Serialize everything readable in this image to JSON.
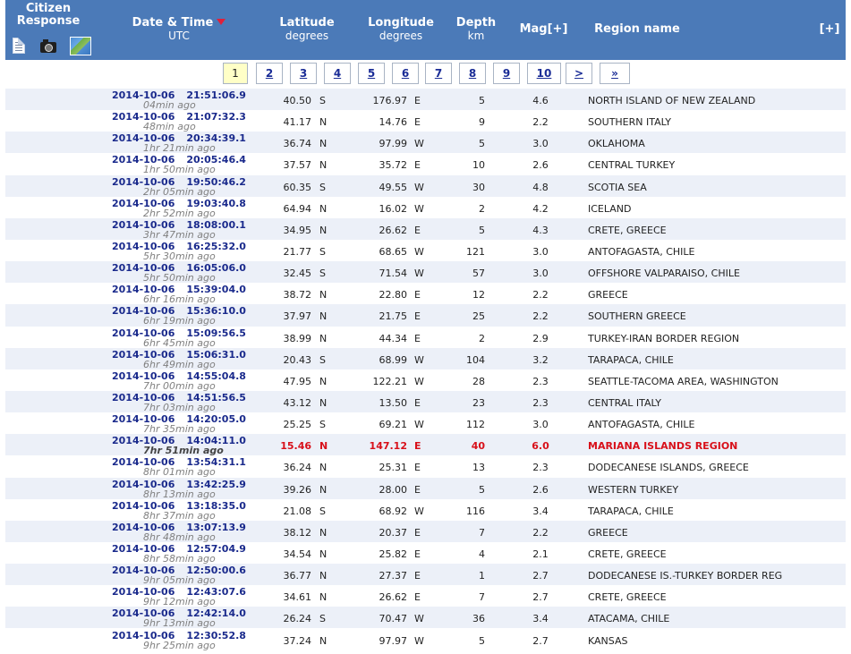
{
  "header": {
    "citizen_response_line1": "Citizen",
    "citizen_response_line2": "Response",
    "icons": [
      "document-icon",
      "camera-icon",
      "map-icon"
    ],
    "datetime_label": "Date & Time",
    "datetime_sub": "UTC",
    "latitude_label": "Latitude",
    "latitude_sub": "degrees",
    "longitude_label": "Longitude",
    "longitude_sub": "degrees",
    "depth_label": "Depth",
    "depth_sub": "km",
    "mag_label": "Mag[+]",
    "region_label": "Region name",
    "expand_label": "[+]",
    "header_bg": "#4b7ab8",
    "sort_arrow_color": "#e0203a"
  },
  "pager": [
    "1",
    "2",
    "3",
    "4",
    "5",
    "6",
    "7",
    "8",
    "9",
    "10",
    ">",
    "»"
  ],
  "pager_active": "1",
  "rows": [
    {
      "date": "2014-10-06",
      "time": "21:51:06.9",
      "ago": "04min ago",
      "lat": "40.50",
      "ns": "S",
      "lon": "176.97",
      "ew": "E",
      "depth": "5",
      "mag": "4.6",
      "region": "NORTH ISLAND OF NEW ZEALAND"
    },
    {
      "date": "2014-10-06",
      "time": "21:07:32.3",
      "ago": "48min ago",
      "lat": "41.17",
      "ns": "N",
      "lon": "14.76",
      "ew": "E",
      "depth": "9",
      "mag": "2.2",
      "region": "SOUTHERN ITALY"
    },
    {
      "date": "2014-10-06",
      "time": "20:34:39.1",
      "ago": "1hr 21min ago",
      "lat": "36.74",
      "ns": "N",
      "lon": "97.99",
      "ew": "W",
      "depth": "5",
      "mag": "3.0",
      "region": "OKLAHOMA"
    },
    {
      "date": "2014-10-06",
      "time": "20:05:46.4",
      "ago": "1hr 50min ago",
      "lat": "37.57",
      "ns": "N",
      "lon": "35.72",
      "ew": "E",
      "depth": "10",
      "mag": "2.6",
      "region": "CENTRAL TURKEY"
    },
    {
      "date": "2014-10-06",
      "time": "19:50:46.2",
      "ago": "2hr 05min ago",
      "lat": "60.35",
      "ns": "S",
      "lon": "49.55",
      "ew": "W",
      "depth": "30",
      "mag": "4.8",
      "region": "SCOTIA SEA"
    },
    {
      "date": "2014-10-06",
      "time": "19:03:40.8",
      "ago": "2hr 52min ago",
      "lat": "64.94",
      "ns": "N",
      "lon": "16.02",
      "ew": "W",
      "depth": "2",
      "mag": "4.2",
      "region": "ICELAND"
    },
    {
      "date": "2014-10-06",
      "time": "18:08:00.1",
      "ago": "3hr 47min ago",
      "lat": "34.95",
      "ns": "N",
      "lon": "26.62",
      "ew": "E",
      "depth": "5",
      "mag": "4.3",
      "region": "CRETE, GREECE"
    },
    {
      "date": "2014-10-06",
      "time": "16:25:32.0",
      "ago": "5hr 30min ago",
      "lat": "21.77",
      "ns": "S",
      "lon": "68.65",
      "ew": "W",
      "depth": "121",
      "mag": "3.0",
      "region": "ANTOFAGASTA, CHILE"
    },
    {
      "date": "2014-10-06",
      "time": "16:05:06.0",
      "ago": "5hr 50min ago",
      "lat": "32.45",
      "ns": "S",
      "lon": "71.54",
      "ew": "W",
      "depth": "57",
      "mag": "3.0",
      "region": "OFFSHORE VALPARAISO, CHILE"
    },
    {
      "date": "2014-10-06",
      "time": "15:39:04.0",
      "ago": "6hr 16min ago",
      "lat": "38.72",
      "ns": "N",
      "lon": "22.80",
      "ew": "E",
      "depth": "12",
      "mag": "2.2",
      "region": "GREECE"
    },
    {
      "date": "2014-10-06",
      "time": "15:36:10.0",
      "ago": "6hr 19min ago",
      "lat": "37.97",
      "ns": "N",
      "lon": "21.75",
      "ew": "E",
      "depth": "25",
      "mag": "2.2",
      "region": "SOUTHERN GREECE"
    },
    {
      "date": "2014-10-06",
      "time": "15:09:56.5",
      "ago": "6hr 45min ago",
      "lat": "38.99",
      "ns": "N",
      "lon": "44.34",
      "ew": "E",
      "depth": "2",
      "mag": "2.9",
      "region": "TURKEY-IRAN BORDER REGION"
    },
    {
      "date": "2014-10-06",
      "time": "15:06:31.0",
      "ago": "6hr 49min ago",
      "lat": "20.43",
      "ns": "S",
      "lon": "68.99",
      "ew": "W",
      "depth": "104",
      "mag": "3.2",
      "region": "TARAPACA, CHILE"
    },
    {
      "date": "2014-10-06",
      "time": "14:55:04.8",
      "ago": "7hr 00min ago",
      "lat": "47.95",
      "ns": "N",
      "lon": "122.21",
      "ew": "W",
      "depth": "28",
      "mag": "2.3",
      "region": "SEATTLE-TACOMA AREA, WASHINGTON"
    },
    {
      "date": "2014-10-06",
      "time": "14:51:56.5",
      "ago": "7hr 03min ago",
      "lat": "43.12",
      "ns": "N",
      "lon": "13.50",
      "ew": "E",
      "depth": "23",
      "mag": "2.3",
      "region": "CENTRAL ITALY"
    },
    {
      "date": "2014-10-06",
      "time": "14:20:05.0",
      "ago": "7hr 35min ago",
      "lat": "25.25",
      "ns": "S",
      "lon": "69.21",
      "ew": "W",
      "depth": "112",
      "mag": "3.0",
      "region": "ANTOFAGASTA, CHILE"
    },
    {
      "date": "2014-10-06",
      "time": "14:04:11.0",
      "ago": "7hr 51min ago",
      "lat": "15.46",
      "ns": "N",
      "lon": "147.12",
      "ew": "E",
      "depth": "40",
      "mag": "6.0",
      "region": "MARIANA ISLANDS REGION",
      "major": true
    },
    {
      "date": "2014-10-06",
      "time": "13:54:31.1",
      "ago": "8hr 01min ago",
      "lat": "36.24",
      "ns": "N",
      "lon": "25.31",
      "ew": "E",
      "depth": "13",
      "mag": "2.3",
      "region": "DODECANESE ISLANDS, GREECE"
    },
    {
      "date": "2014-10-06",
      "time": "13:42:25.9",
      "ago": "8hr 13min ago",
      "lat": "39.26",
      "ns": "N",
      "lon": "28.00",
      "ew": "E",
      "depth": "5",
      "mag": "2.6",
      "region": "WESTERN TURKEY"
    },
    {
      "date": "2014-10-06",
      "time": "13:18:35.0",
      "ago": "8hr 37min ago",
      "lat": "21.08",
      "ns": "S",
      "lon": "68.92",
      "ew": "W",
      "depth": "116",
      "mag": "3.4",
      "region": "TARAPACA, CHILE"
    },
    {
      "date": "2014-10-06",
      "time": "13:07:13.9",
      "ago": "8hr 48min ago",
      "lat": "38.12",
      "ns": "N",
      "lon": "20.37",
      "ew": "E",
      "depth": "7",
      "mag": "2.2",
      "region": "GREECE"
    },
    {
      "date": "2014-10-06",
      "time": "12:57:04.9",
      "ago": "8hr 58min ago",
      "lat": "34.54",
      "ns": "N",
      "lon": "25.82",
      "ew": "E",
      "depth": "4",
      "mag": "2.1",
      "region": "CRETE, GREECE"
    },
    {
      "date": "2014-10-06",
      "time": "12:50:00.6",
      "ago": "9hr 05min ago",
      "lat": "36.77",
      "ns": "N",
      "lon": "27.37",
      "ew": "E",
      "depth": "1",
      "mag": "2.7",
      "region": "DODECANESE IS.-TURKEY BORDER REG"
    },
    {
      "date": "2014-10-06",
      "time": "12:43:07.6",
      "ago": "9hr 12min ago",
      "lat": "34.61",
      "ns": "N",
      "lon": "26.62",
      "ew": "E",
      "depth": "7",
      "mag": "2.7",
      "region": "CRETE, GREECE"
    },
    {
      "date": "2014-10-06",
      "time": "12:42:14.0",
      "ago": "9hr 13min ago",
      "lat": "26.24",
      "ns": "S",
      "lon": "70.47",
      "ew": "W",
      "depth": "36",
      "mag": "3.4",
      "region": "ATACAMA, CHILE"
    },
    {
      "date": "2014-10-06",
      "time": "12:30:52.8",
      "ago": "9hr 25min ago",
      "lat": "37.24",
      "ns": "N",
      "lon": "97.97",
      "ew": "W",
      "depth": "5",
      "mag": "2.7",
      "region": "KANSAS"
    }
  ]
}
